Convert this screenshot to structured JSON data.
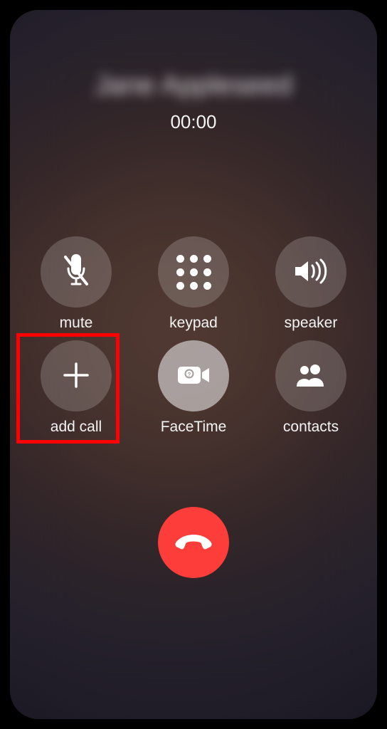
{
  "caller": {
    "name": "Jane Appleseed",
    "timer": "00:00"
  },
  "buttons": {
    "mute": {
      "label": "mute"
    },
    "keypad": {
      "label": "keypad"
    },
    "speaker": {
      "label": "speaker"
    },
    "addcall": {
      "label": "add call"
    },
    "facetime": {
      "label": "FaceTime"
    },
    "contacts": {
      "label": "contacts"
    }
  },
  "highlight": {
    "target": "addcall"
  }
}
